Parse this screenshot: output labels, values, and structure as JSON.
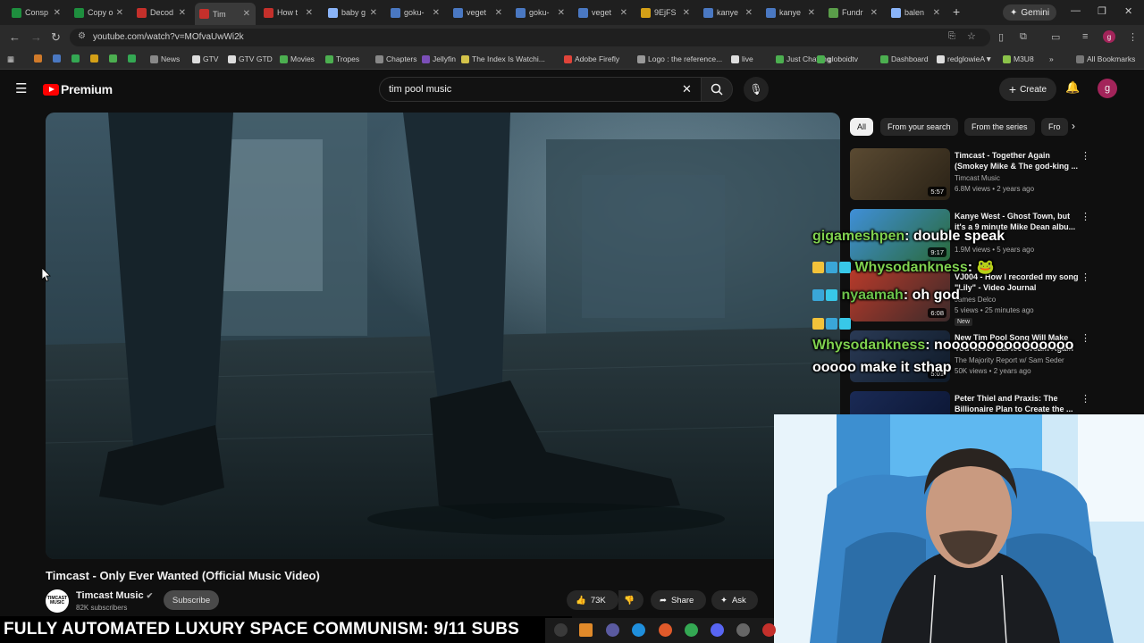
{
  "browser": {
    "tabs": [
      {
        "label": "Consp",
        "color": "#1e8e3e"
      },
      {
        "label": "Copy o",
        "color": "#1e8e3e"
      },
      {
        "label": "Decod",
        "color": "#c4302b"
      },
      {
        "label": "Tim",
        "color": "#c4302b"
      },
      {
        "label": "How t",
        "color": "#c4302b"
      },
      {
        "label": "baby g",
        "color": "#8ab4f8"
      },
      {
        "label": "goku-",
        "color": "#4a78c2"
      },
      {
        "label": "veget",
        "color": "#4a78c2"
      },
      {
        "label": "goku-",
        "color": "#4a78c2"
      },
      {
        "label": "veget",
        "color": "#4a78c2"
      },
      {
        "label": "9EjFS",
        "color": "#d4a017"
      },
      {
        "label": "kanye",
        "color": "#4a78c2"
      },
      {
        "label": "kanye",
        "color": "#4a78c2"
      },
      {
        "label": "Fundr",
        "color": "#5a9e4a"
      },
      {
        "label": "balen",
        "color": "#8ab4f8"
      }
    ],
    "new_tab": "+",
    "gemini_label": "Gemini",
    "url": "youtube.com/watch?v=MOfvaUwWi2k",
    "bookmarks": [
      "News",
      "GTV",
      "GTV GTD",
      "Movies",
      "Tropes",
      "Chapters",
      "Jellyfin",
      "The Index Is Watchi...",
      "Adobe Firefly",
      "Logo : the reference...",
      "live",
      "Just Chatting",
      "globoidtv",
      "Dashboard",
      "redglowieA▼",
      "M3U8"
    ],
    "all_bookmarks": "All Bookmarks"
  },
  "youtube": {
    "logo_text": "Premium",
    "search_value": "tim pool music",
    "create_label": "Create",
    "avatar_letter": "g",
    "video_title": "Timcast - Only Ever Wanted (Official Music Video)",
    "channel_avatar_text": "TIMCAST MUSIC",
    "channel_name": "Timcast Music",
    "channel_subs": "82K subscribers",
    "subscribe_label": "Subscribe",
    "like_count": "73K",
    "share_label": "Share",
    "ask_label": "Ask",
    "chips": [
      "All",
      "From your search",
      "From the series",
      "Fro"
    ],
    "recommendations": [
      {
        "title": "Timcast - Together Again (Smokey Mike & The god-king ...",
        "channel": "Timcast Music",
        "meta": "6.8M views • 2 years ago",
        "duration": "5:57"
      },
      {
        "title": "Kanye West - Ghost Town, but it's a 9 minute Mike Dean albu...",
        "channel": "",
        "meta": "1.9M views • 5 years ago",
        "duration": "9:17"
      },
      {
        "title": "VJ004 - How I recorded my song \"Lily\" - Video Journal",
        "channel": "James Delco",
        "meta": "5 views • 25 minutes ago",
        "duration": "6:08",
        "badge": "New"
      },
      {
        "title": "New Tim Pool Song Will Make You Never Eat Ice Cream Again",
        "channel": "The Majority Report w/ Sam Seder",
        "meta": "50K views • 2 years ago",
        "duration": "5:01"
      },
      {
        "title": "Peter Thiel and Praxis: The Billionaire Plan to Create the ...",
        "channel": "",
        "meta": "",
        "duration": ""
      }
    ]
  },
  "chat": [
    {
      "user": "gigameshpen",
      "color": "#7fd14f",
      "message": "double speak"
    },
    {
      "user": "Whysodankness",
      "color": "#7fd14f",
      "message": ""
    },
    {
      "user": "nyaamah",
      "color": "#6cc24a",
      "message": "oh god"
    },
    {
      "user": "Whysodankness",
      "color": "#7fd14f",
      "message": "nooooooooooooooo"
    },
    {
      "user": "",
      "color": "#ffffff",
      "message": "ooooo make it sthap"
    }
  ],
  "banner": {
    "text": "FULLY AUTOMATED LUXURY SPACE COMMUNISM: 9/11 SUBS"
  }
}
